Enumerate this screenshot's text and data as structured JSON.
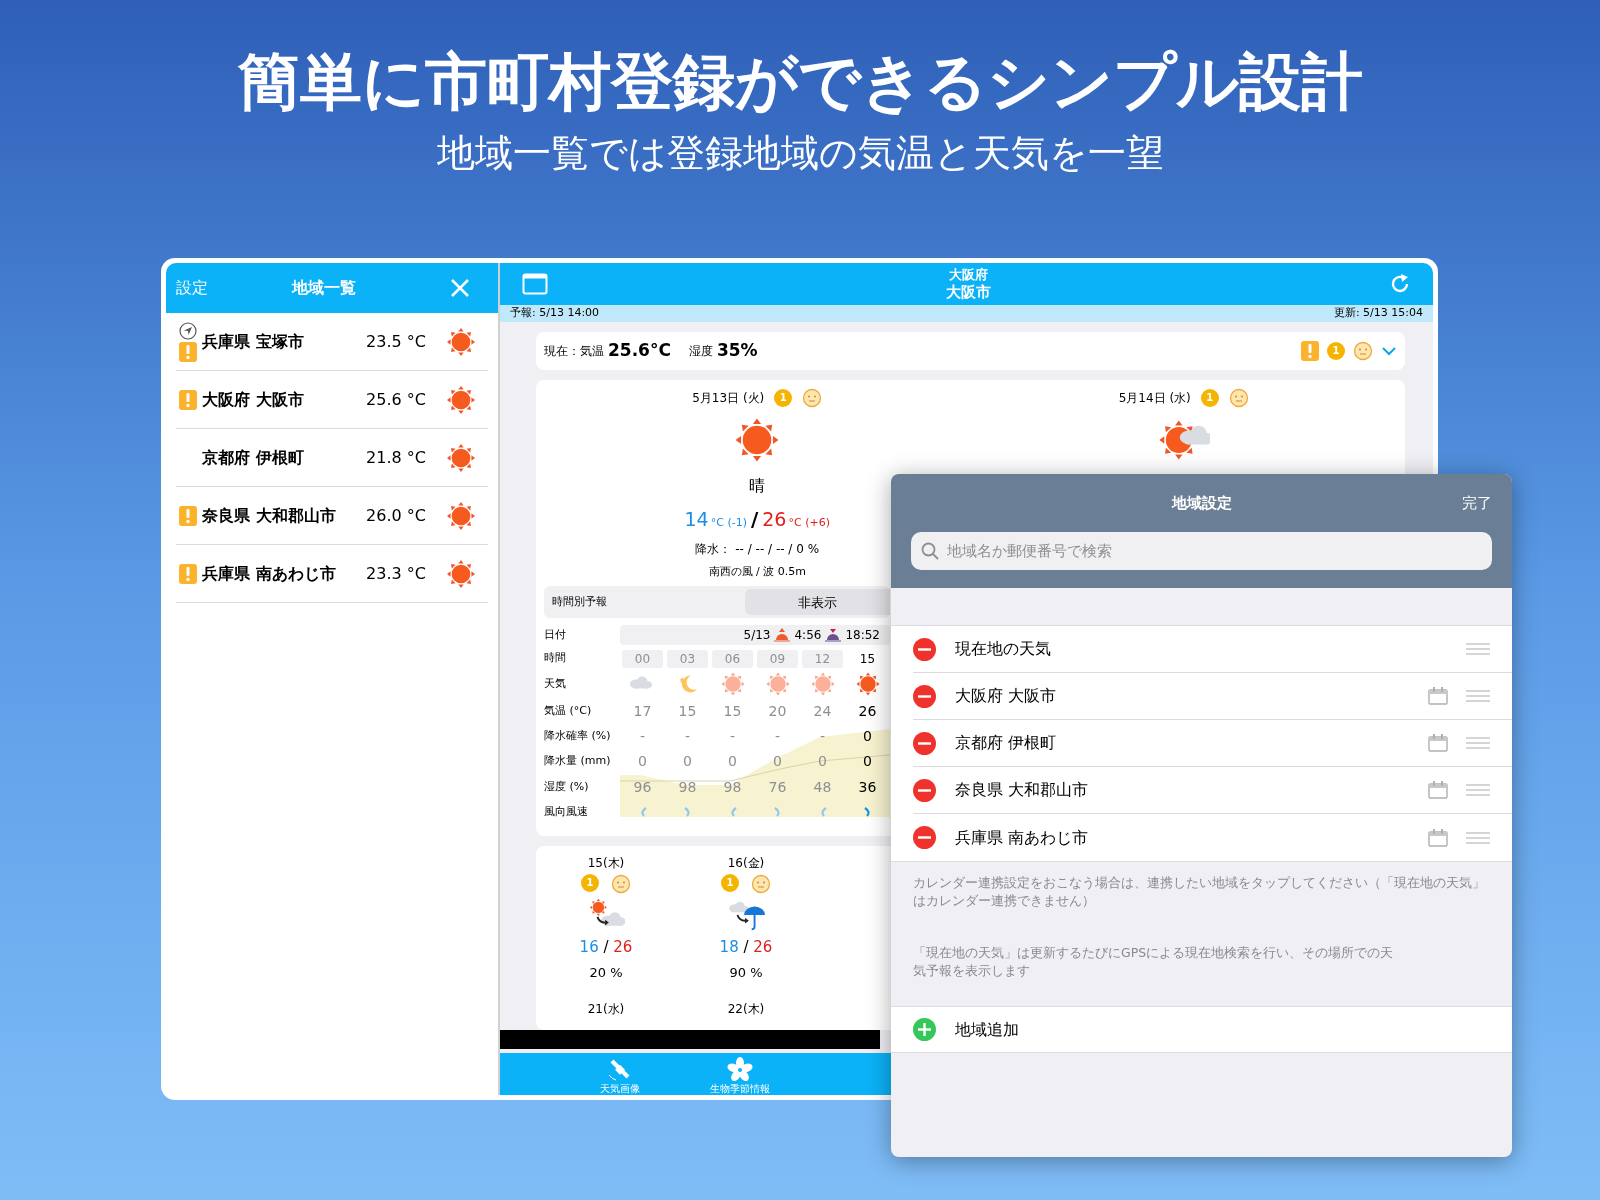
{
  "promo": {
    "headline": "簡単に市町村登録ができるシンプル設計",
    "subheadline": "地域一覧では登録地域の気温と天気を一望"
  },
  "sidebar": {
    "settings": "設定",
    "title": "地域一覧",
    "items": [
      {
        "name": "兵庫県 宝塚市",
        "temp": "23.5 °C",
        "warning": true,
        "location": true,
        "kind": "sunny"
      },
      {
        "name": "大阪府 大阪市",
        "temp": "25.6 °C",
        "warning": true,
        "location": false,
        "kind": "sunny"
      },
      {
        "name": "京都府 伊根町",
        "temp": "21.8 °C",
        "warning": false,
        "location": false,
        "kind": "sunny"
      },
      {
        "name": "奈良県 大和郡山市",
        "temp": "26.0 °C",
        "warning": true,
        "location": false,
        "kind": "sunny"
      },
      {
        "name": "兵庫県 南あわじ市",
        "temp": "23.3 °C",
        "warning": true,
        "location": false,
        "kind": "sunny"
      }
    ]
  },
  "main": {
    "prefecture": "大阪府",
    "city": "大阪市",
    "forecast_time": "予報: 5/13 14:00",
    "updated": "更新: 5/13 15:04",
    "current": {
      "label": "現在：気温",
      "temp": "25.6°C",
      "humidity_label": "湿度",
      "humidity": "35%",
      "warning": true,
      "badge": "1"
    },
    "days": [
      {
        "date": "5月13日 (火)",
        "badge": "1",
        "kind": "sunny",
        "condition": "晴",
        "low": "14",
        "low_unit": "°C",
        "low_diff": "(-1)",
        "separator": "/",
        "high": "26",
        "high_unit": "°C",
        "high_diff": "(+6)",
        "precip": "降水： -- / -- / -- / 0 %",
        "wind": "南西の風 / 波 0.5m"
      },
      {
        "date": "5月14日 (水)",
        "badge": "1",
        "kind": "sunny_cloudy"
      }
    ],
    "hourly": {
      "title": "時間別予報",
      "toggle": "非表示",
      "row_labels": [
        "日付",
        "時間",
        "天気",
        "気温 (°C)",
        "降水確率 (%)",
        "降水量 (mm)",
        "湿度 (%)",
        "風向風速"
      ],
      "date": "5/13",
      "sunrise": "4:56",
      "sunset": "18:52",
      "hours": [
        {
          "time": "00",
          "kind": "cloudy",
          "temp": "17",
          "pop": "-",
          "rain": "0",
          "humidity": "96",
          "current": false
        },
        {
          "time": "03",
          "kind": "moon",
          "temp": "15",
          "pop": "-",
          "rain": "0",
          "humidity": "98",
          "current": false
        },
        {
          "time": "06",
          "kind": "sunny",
          "temp": "15",
          "pop": "-",
          "rain": "0",
          "humidity": "98",
          "current": false
        },
        {
          "time": "09",
          "kind": "sunny",
          "temp": "20",
          "pop": "-",
          "rain": "0",
          "humidity": "76",
          "current": false
        },
        {
          "time": "12",
          "kind": "sunny",
          "temp": "24",
          "pop": "-",
          "rain": "0",
          "humidity": "48",
          "current": false
        },
        {
          "time": "15",
          "kind": "sunny",
          "temp": "26",
          "pop": "0",
          "rain": "0",
          "humidity": "36",
          "current": true
        }
      ]
    },
    "weekly": [
      {
        "date": "15(木)",
        "badge": "1",
        "kind": "sunny_to_cloudy",
        "low": "16",
        "separator": "/",
        "high": "26",
        "pop": "20 %"
      },
      {
        "date": "16(金)",
        "badge": "1",
        "kind": "cloudy_to_rain",
        "low": "18",
        "separator": "/",
        "high": "26",
        "pop": "90 %"
      }
    ],
    "weekly_next": [
      "21(水)",
      "22(木)"
    ],
    "tabbar": [
      {
        "label": "天気画像",
        "kind": "satellite"
      },
      {
        "label": "生物季節情報",
        "kind": "flower"
      }
    ]
  },
  "region_settings": {
    "title": "地域設定",
    "done": "完了",
    "search_placeholder": "地域名か郵便番号で検索",
    "items": [
      {
        "name": "現在地の天気",
        "calendar": false
      },
      {
        "name": "大阪府 大阪市",
        "calendar": true
      },
      {
        "name": "京都府 伊根町",
        "calendar": true
      },
      {
        "name": "奈良県 大和郡山市",
        "calendar": true
      },
      {
        "name": "兵庫県 南あわじ市",
        "calendar": true
      }
    ],
    "note1": "カレンダー連携設定をおこなう場合は、連携したい地域をタップしてください（「現在地の天気」はカレンダー連携できません）",
    "note2": "「現在地の天気」は更新するたびにGPSによる現在地検索を行い、その場所での天気予報を表示します",
    "add": "地域追加"
  }
}
